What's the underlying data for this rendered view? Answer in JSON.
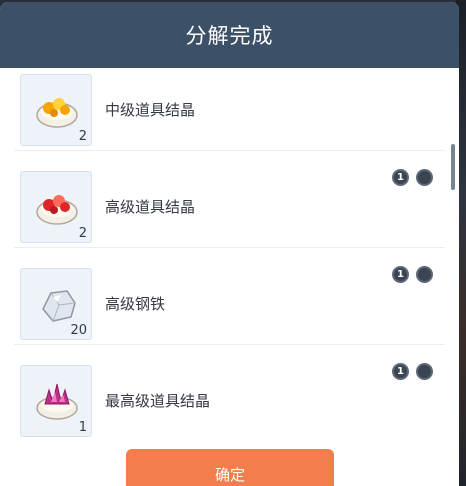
{
  "dialog": {
    "title": "分解完成",
    "confirm_label": "确定"
  },
  "items": [
    {
      "name": "中级道具结晶",
      "qty": "2",
      "icon": "orange-crystal-icon",
      "gem_colors": [
        "#f6a400",
        "#ffd23a"
      ],
      "badges": []
    },
    {
      "name": "高级道具结晶",
      "qty": "2",
      "icon": "red-crystal-icon",
      "gem_colors": [
        "#e0252a",
        "#ff6a5a"
      ],
      "badges": [
        "1",
        ""
      ]
    },
    {
      "name": "高级钢铁",
      "qty": "20",
      "icon": "steel-ore-icon",
      "gem_colors": [
        "#c8d0da",
        "#ffffff"
      ],
      "badges": [
        "1",
        ""
      ]
    },
    {
      "name": "最高级道具结晶",
      "qty": "1",
      "icon": "purple-crystal-icon",
      "gem_colors": [
        "#c0308a",
        "#f27ac4"
      ],
      "badges": [
        "1",
        ""
      ]
    }
  ],
  "colors": {
    "header": "#3c5068",
    "confirm": "#f47d4d"
  }
}
